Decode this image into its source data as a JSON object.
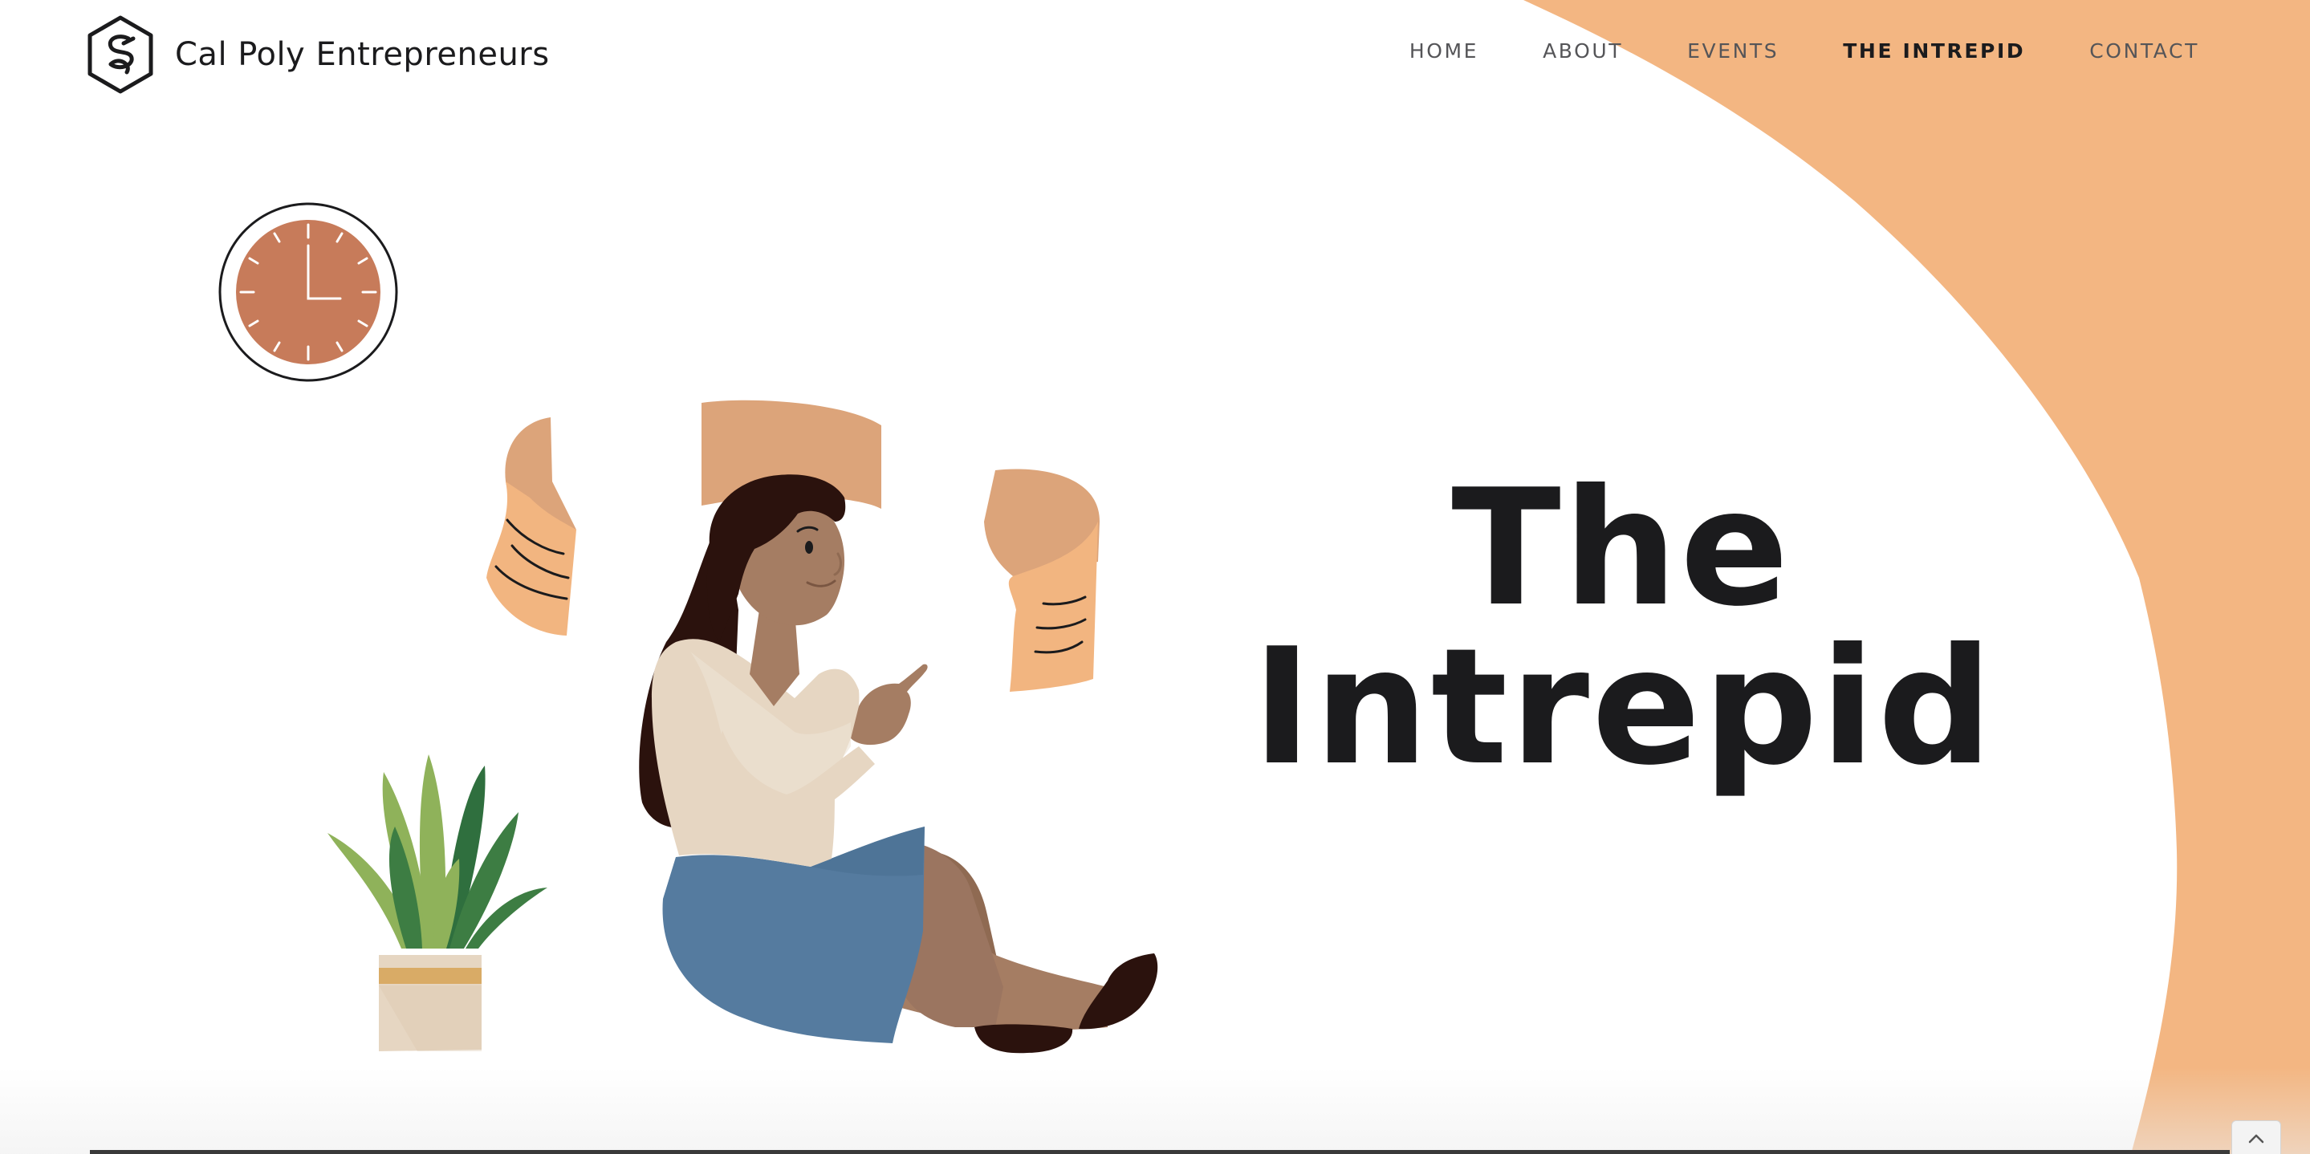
{
  "brand": {
    "name": "Cal Poly Entrepreneurs"
  },
  "nav": {
    "items": [
      {
        "label": "HOME"
      },
      {
        "label": "ABOUT"
      },
      {
        "label": "EVENTS"
      },
      {
        "label": "THE INTREPID",
        "active": true
      },
      {
        "label": "CONTACT"
      }
    ]
  },
  "hero": {
    "title_line1": "The",
    "title_line2": "Intrepid"
  },
  "colors": {
    "accent_peach": "#f3b682",
    "text_dark": "#1b1b1d",
    "nav_text": "#555558",
    "clock_face": "#c77b5a",
    "paper": "#dca47a",
    "paper_light": "#f2b580",
    "skirt": "#557b9f",
    "blouse": "#e6d6c2",
    "skin": "#a57d63",
    "hair": "#2b120d",
    "plant_light": "#8fb25a",
    "plant_dark": "#2f6f3e",
    "pot": "#e6d6c2",
    "pot_band": "#d9ab66"
  },
  "icons": {
    "logo": "cpe-hex-logo-icon",
    "clock": "wall-clock-icon",
    "back_to_top": "chevron-up-icon"
  },
  "illustration": {
    "subject": "woman-sitting-with-floating-papers"
  }
}
